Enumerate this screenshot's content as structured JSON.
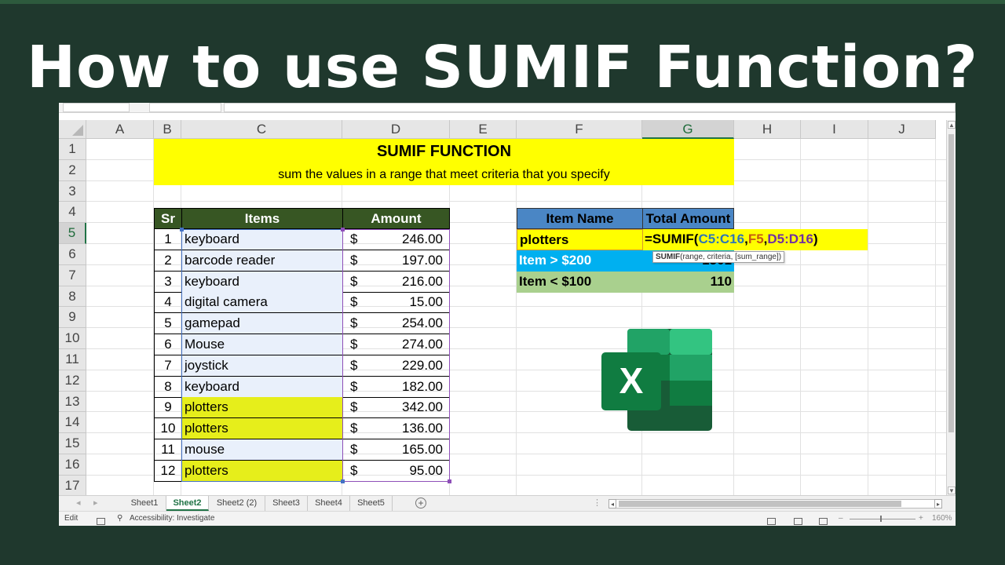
{
  "headline": "How to use SUMIF Function?",
  "columns": [
    "A",
    "B",
    "C",
    "D",
    "E",
    "F",
    "G",
    "H",
    "I",
    "J"
  ],
  "active_column": "G",
  "rows": [
    "1",
    "2",
    "3",
    "4",
    "5",
    "6",
    "7",
    "8",
    "9",
    "10",
    "11",
    "12",
    "13",
    "14",
    "15",
    "16",
    "17"
  ],
  "active_row": "5",
  "banner": {
    "title": "SUMIF FUNCTION",
    "subtitle": "sum the values in a range that meet criteria that you specify"
  },
  "table": {
    "headers": {
      "sr": "Sr",
      "items": "Items",
      "amount": "Amount"
    },
    "currency": "$",
    "rows": [
      {
        "sr": "1",
        "item": "keyboard",
        "amount": "246.00",
        "highlight": false
      },
      {
        "sr": "2",
        "item": "barcode reader",
        "amount": "197.00",
        "highlight": false
      },
      {
        "sr": "3",
        "item": "keyboard",
        "amount": "216.00",
        "highlight": false
      },
      {
        "sr": "4",
        "item": "digital camera",
        "amount": "15.00",
        "highlight": false
      },
      {
        "sr": "5",
        "item": "gamepad",
        "amount": "254.00",
        "highlight": false
      },
      {
        "sr": "6",
        "item": "Mouse",
        "amount": "274.00",
        "highlight": false
      },
      {
        "sr": "7",
        "item": "joystick",
        "amount": "229.00",
        "highlight": false
      },
      {
        "sr": "8",
        "item": "keyboard",
        "amount": "182.00",
        "highlight": false
      },
      {
        "sr": "9",
        "item": "plotters",
        "amount": "342.00",
        "highlight": true
      },
      {
        "sr": "10",
        "item": "plotters",
        "amount": "136.00",
        "highlight": true
      },
      {
        "sr": "11",
        "item": "mouse",
        "amount": "165.00",
        "highlight": false
      },
      {
        "sr": "12",
        "item": "plotters",
        "amount": "95.00",
        "highlight": true
      }
    ]
  },
  "summary": {
    "header_item": "Item Name",
    "header_total": "Total Amount",
    "criteria": "plotters",
    "formula": {
      "prefix": "=SUMIF(",
      "range": "C5:C16",
      "sep1": ",",
      "criteria_ref": "F5",
      "sep2": ",",
      "sum_range": "D5:D16",
      "suffix": ")"
    },
    "tooltip": {
      "fn": "SUMIF",
      "args": "(range, criteria, [sum_range])"
    },
    "row_gt_label": "Item > $200",
    "row_gt_value": "1501",
    "row_lt_label": "Item < $100",
    "row_lt_value": "110"
  },
  "logo_letter": "X",
  "sheet_tabs": [
    "Sheet1",
    "Sheet2",
    "Sheet2 (2)",
    "Sheet3",
    "Sheet4",
    "Sheet5"
  ],
  "active_tab": "Sheet2",
  "status": {
    "mode": "Edit",
    "accessibility": "Accessibility: Investigate",
    "zoom": "160%"
  },
  "colors": {
    "background": "#1f382d",
    "table_header": "#375623",
    "summary_header": "#4a86c5",
    "banner": "#ffff00",
    "highlight": "#e6ee1b",
    "excel_green": "#217346"
  }
}
